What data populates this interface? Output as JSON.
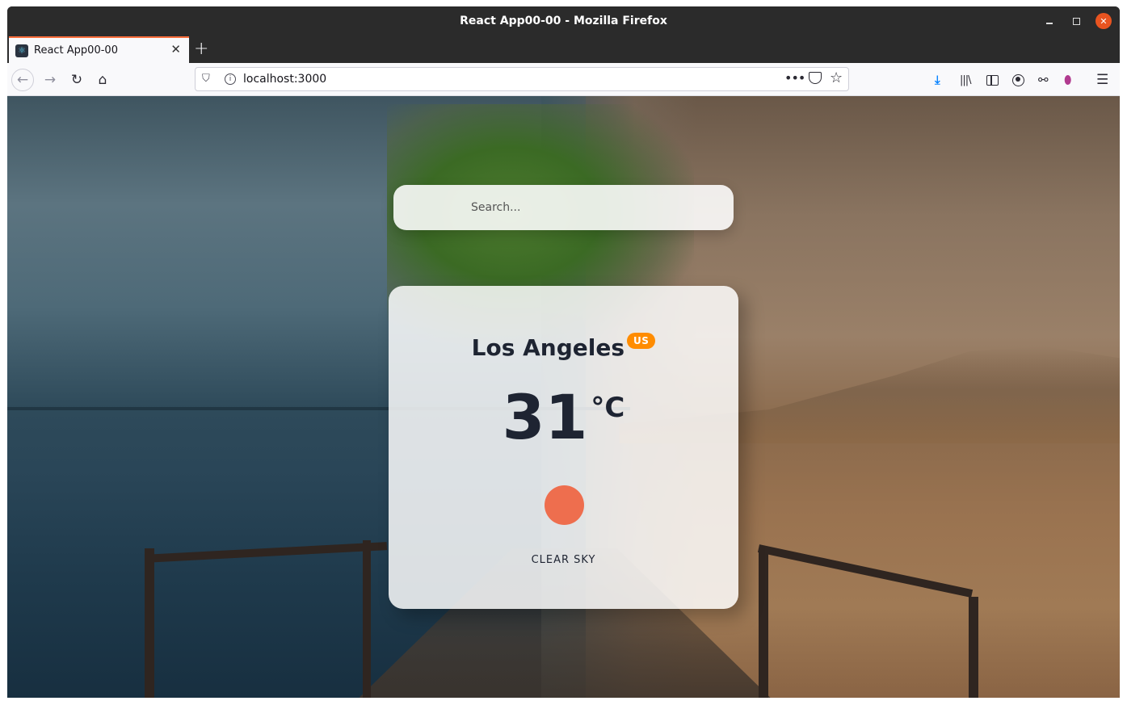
{
  "window": {
    "title": "React App00-00 - Mozilla Firefox"
  },
  "tab": {
    "label": "React App00-00",
    "close_glyph": "✕"
  },
  "urlbar": {
    "url": "localhost:3000"
  },
  "search": {
    "placeholder": "Search..."
  },
  "weather": {
    "city": "Los Angeles",
    "country": "US",
    "temperature": "31",
    "unit": "°C",
    "description": "CLEAR SKY",
    "icon": "sun-icon",
    "icon_color": "#ee6e4e"
  },
  "colors": {
    "badge": "#ff8c00",
    "tab_accent": "#ff6d3b",
    "close_button": "#e95420"
  },
  "icons": {
    "back": "back-arrow-icon",
    "forward": "forward-arrow-icon",
    "reload": "reload-icon",
    "home": "home-icon",
    "download": "download-icon",
    "library": "library-icon",
    "sidebar": "sidebar-icon",
    "account": "account-icon",
    "extension1": "extension-icon",
    "extension2": "location-pin-icon",
    "menu": "hamburger-menu-icon"
  }
}
